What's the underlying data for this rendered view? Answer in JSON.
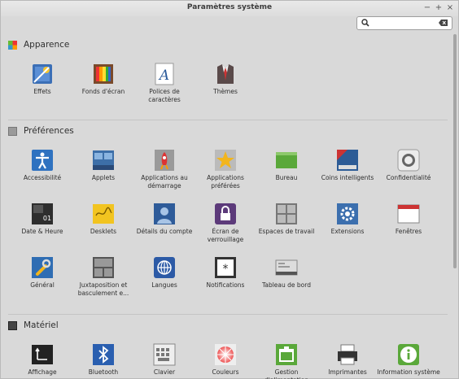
{
  "window": {
    "title": "Paramètres système"
  },
  "controls": {
    "minimize": "−",
    "maximize": "+",
    "close": "×"
  },
  "search": {
    "value": "",
    "placeholder": ""
  },
  "sections": {
    "appearance": {
      "title": "Apparence",
      "items": [
        "Effets",
        "Fonds d'écran",
        "Polices de caractères",
        "Thèmes"
      ]
    },
    "preferences": {
      "title": "Préférences",
      "items": [
        "Accessibilité",
        "Applets",
        "Applications au démarrage",
        "Applications préférées",
        "Bureau",
        "Coins intelligents",
        "Confidentialité",
        "Date & Heure",
        "Desklets",
        "Détails du compte",
        "Écran de verrouillage",
        "Espaces de travail",
        "Extensions",
        "Fenêtres",
        "Général",
        "Juxtaposition et basculement e...",
        "Langues",
        "Notifications",
        "Tableau de bord"
      ]
    },
    "hardware": {
      "title": "Matériel",
      "items": [
        "Affichage",
        "Bluetooth",
        "Clavier",
        "Couleurs",
        "Gestion d'alimentation",
        "Imprimantes",
        "Information système"
      ]
    }
  },
  "accent": {
    "blue": "#3b7fc4",
    "green": "#5aa83a"
  }
}
